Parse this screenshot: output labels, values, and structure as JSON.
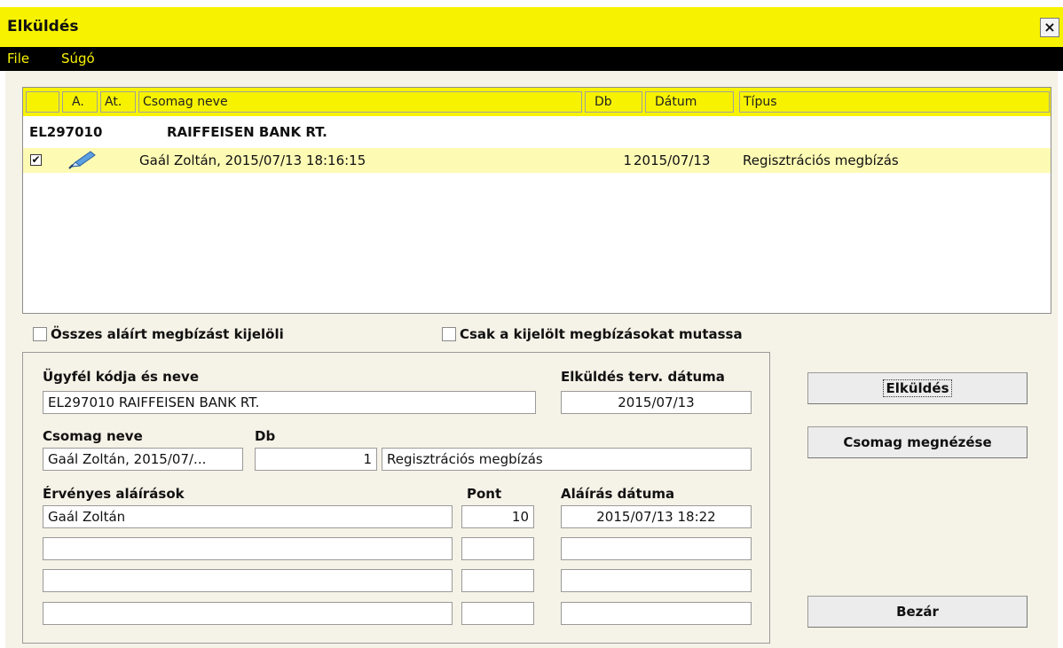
{
  "window": {
    "title": "Elküldés",
    "close_label": "×"
  },
  "menu": {
    "file": "File",
    "sugo": "Súgó"
  },
  "table": {
    "headers": [
      "",
      "A.",
      "At.",
      "Csomag neve",
      "Db",
      "Dátum",
      "Típus"
    ],
    "group": {
      "code": "EL297010",
      "name": "RAIFFEISEN BANK RT."
    },
    "rows": [
      {
        "checked": true,
        "name": "Gaál Zoltán, 2015/07/13 18:16:15",
        "db": "1",
        "date": "2015/07/13",
        "type": "Regisztrációs megbízás"
      }
    ]
  },
  "options": {
    "select_all_label": "Összes aláírt megbízást kijelöli",
    "show_selected_label": "Csak a kijelölt megbízásokat mutassa"
  },
  "details": {
    "client_label": "Ügyfél kódja és neve",
    "client_value": "EL297010  RAIFFEISEN BANK RT.",
    "send_date_label": "Elküldés terv. dátuma",
    "send_date_value": "2015/07/13",
    "package_label": "Csomag neve",
    "package_value": "Gaál Zoltán, 2015/07/...",
    "db_label": "Db",
    "db_value": "1",
    "type_value": "Regisztrációs megbízás",
    "signatures_label": "Érvényes aláírások",
    "points_label": "Pont",
    "sign_date_label": "Aláírás dátuma",
    "signatures": [
      {
        "name": "Gaál Zoltán",
        "points": "10",
        "date": "2015/07/13 18:22"
      },
      {
        "name": "",
        "points": "",
        "date": ""
      },
      {
        "name": "",
        "points": "",
        "date": ""
      },
      {
        "name": "",
        "points": "",
        "date": ""
      }
    ]
  },
  "buttons": {
    "send": "Elküldés",
    "view": "Csomag megnézése",
    "close": "Bezár"
  }
}
